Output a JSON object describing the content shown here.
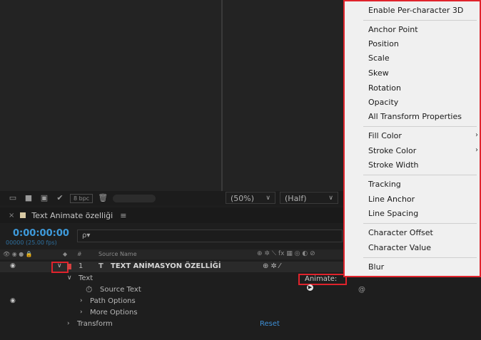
{
  "project_toolbar": {
    "bpc_label": "8 bpc"
  },
  "viewer": {
    "zoom": "(50%)",
    "resolution": "(Half)"
  },
  "timeline": {
    "tab_title": "Text Animate özelliği",
    "timecode": "0:00:00:00",
    "fps_label": "00000 (25.00 fps)",
    "search_placeholder": "ρ▾",
    "header": {
      "col_hash": "#",
      "col_source_name": "Source Name"
    },
    "layer": {
      "number": "1",
      "type_glyph": "T",
      "name": "TEXT ANİMASYON ÖZELLİĞİ"
    },
    "text_group": "Text",
    "source_text": "Source Text",
    "path_options": "Path Options",
    "more_options": "More Options",
    "transform": "Transform",
    "reset": "Reset",
    "animate_label": "Animate:"
  },
  "animate_menu": {
    "items": [
      "Enable Per-character 3D",
      "Anchor Point",
      "Position",
      "Scale",
      "Skew",
      "Rotation",
      "Opacity",
      "All Transform Properties",
      "Fill Color",
      "Stroke Color",
      "Stroke Width",
      "Tracking",
      "Line Anchor",
      "Line Spacing",
      "Character Offset",
      "Character Value",
      "Blur"
    ]
  },
  "colors": {
    "timecode": "#3e9bdc",
    "highlight_box": "#e0232c",
    "menu_bg": "#f0f0f0"
  }
}
